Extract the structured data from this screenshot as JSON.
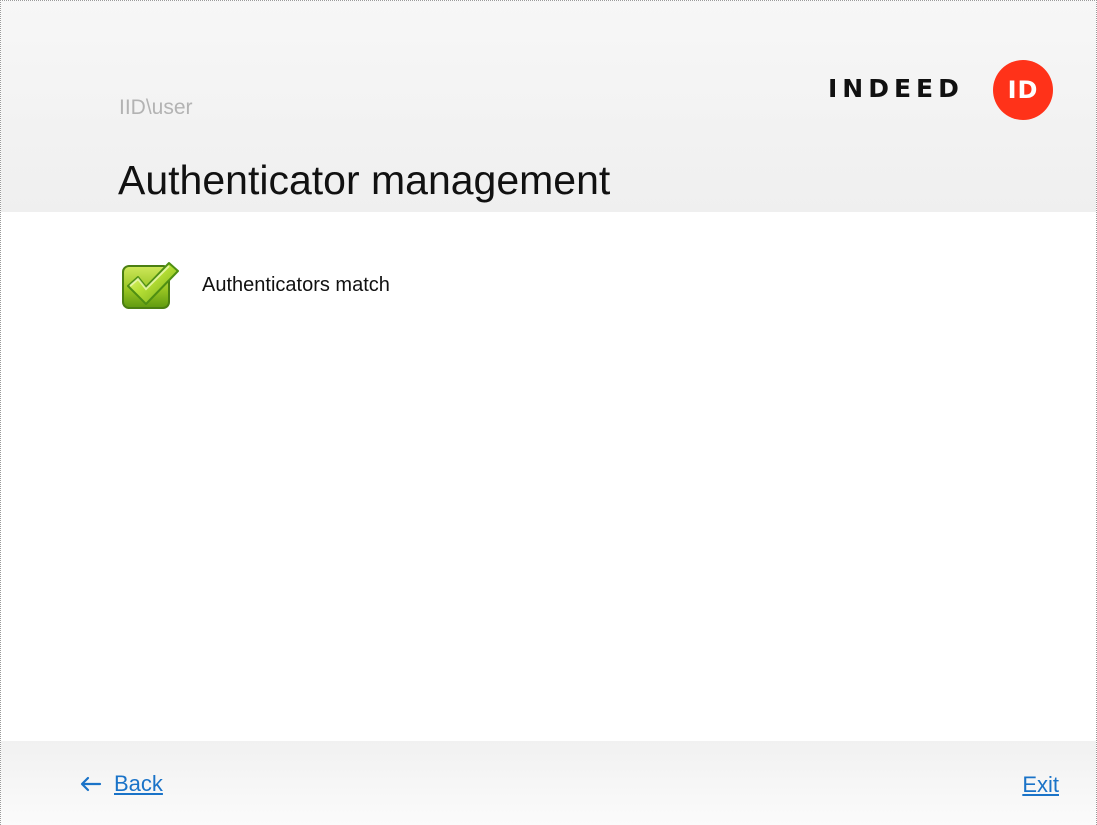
{
  "window": {
    "user": "IID\\user",
    "title": "Authenticator management"
  },
  "brand": {
    "wordmark": "INDEED",
    "badge_text": "ID",
    "badge_color": "#ff3219"
  },
  "status": {
    "icon": "checkmark-icon",
    "message": "Authenticators match"
  },
  "navigation": {
    "back_label": "Back",
    "exit_label": "Exit"
  },
  "colors": {
    "link": "#1a73c8",
    "success": "#7fbe1d"
  }
}
